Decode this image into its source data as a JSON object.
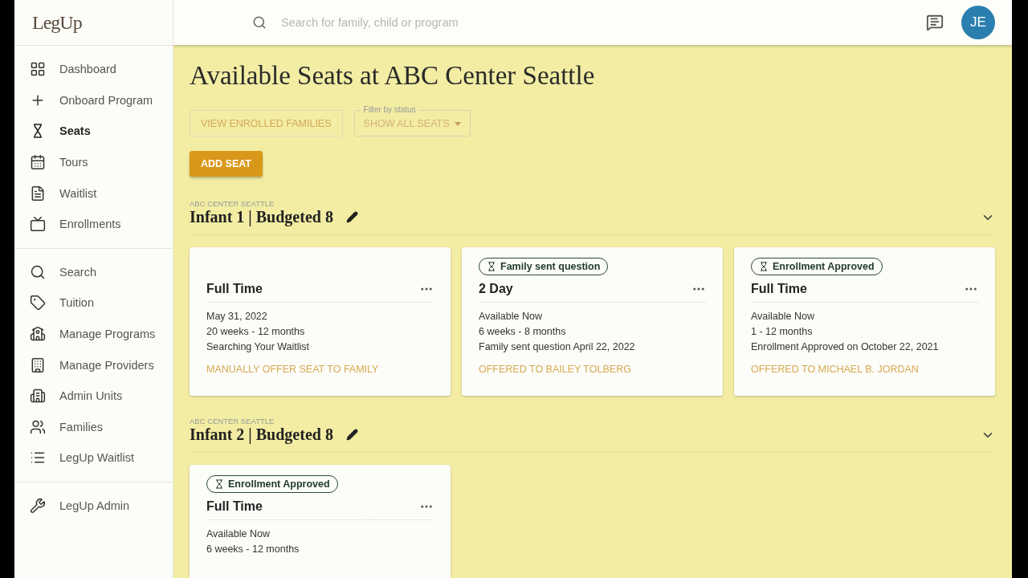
{
  "header": {
    "logo": "LegUp",
    "search_placeholder": "Search for family, child or program",
    "avatar": "JE"
  },
  "sidebar": {
    "groups": [
      [
        {
          "label": "Dashboard",
          "selected": false
        },
        {
          "label": "Onboard Program",
          "selected": false
        },
        {
          "label": "Seats",
          "selected": true
        },
        {
          "label": "Tours",
          "selected": false
        },
        {
          "label": "Waitlist",
          "selected": false
        },
        {
          "label": "Enrollments",
          "selected": false
        }
      ],
      [
        {
          "label": "Search",
          "selected": false
        },
        {
          "label": "Tuition",
          "selected": false
        },
        {
          "label": "Manage Programs",
          "selected": false
        },
        {
          "label": "Manage Providers",
          "selected": false
        },
        {
          "label": "Admin Units",
          "selected": false
        },
        {
          "label": "Families",
          "selected": false
        },
        {
          "label": "LegUp Waitlist",
          "selected": false
        }
      ],
      [
        {
          "label": "LegUp Admin",
          "selected": false
        }
      ]
    ]
  },
  "page": {
    "title": "Available Seats at ABC Center Seattle",
    "view_button": "VIEW ENROLLED FAMILIES",
    "filter": {
      "label": "Filter by status",
      "value": "SHOW ALL SEATS"
    },
    "add_button": "ADD SEAT"
  },
  "sections": [
    {
      "center": "ABC CENTER SEATTLE",
      "title": "Infant 1 | Budgeted 8",
      "expanded": true,
      "seats": [
        {
          "type": "Full Time",
          "lines": [
            "May 31, 2022",
            "20 weeks - 12 months",
            "Searching Your Waitlist"
          ],
          "action": "MANUALLY OFFER SEAT TO FAMILY"
        },
        {
          "badge": "Family sent question",
          "type": "2 Day",
          "lines": [
            "Available Now",
            "6 weeks - 8 months",
            "Family sent question April 22, 2022"
          ],
          "action": "OFFERED TO BAILEY TOLBERG"
        },
        {
          "badge": "Enrollment Approved",
          "type": "Full Time",
          "lines": [
            "Available Now",
            "1 - 12 months",
            "Enrollment Approved on October 22, 2021"
          ],
          "action": "OFFERED TO MICHAEL B. JORDAN"
        }
      ]
    },
    {
      "center": "ABC CENTER SEATTLE",
      "title": "Infant 2 | Budgeted 8",
      "expanded": true,
      "seats": [
        {
          "badge": "Enrollment Approved",
          "type": "Full Time",
          "lines": [
            "Available Now",
            "6 weeks - 12 months"
          ]
        }
      ]
    }
  ]
}
